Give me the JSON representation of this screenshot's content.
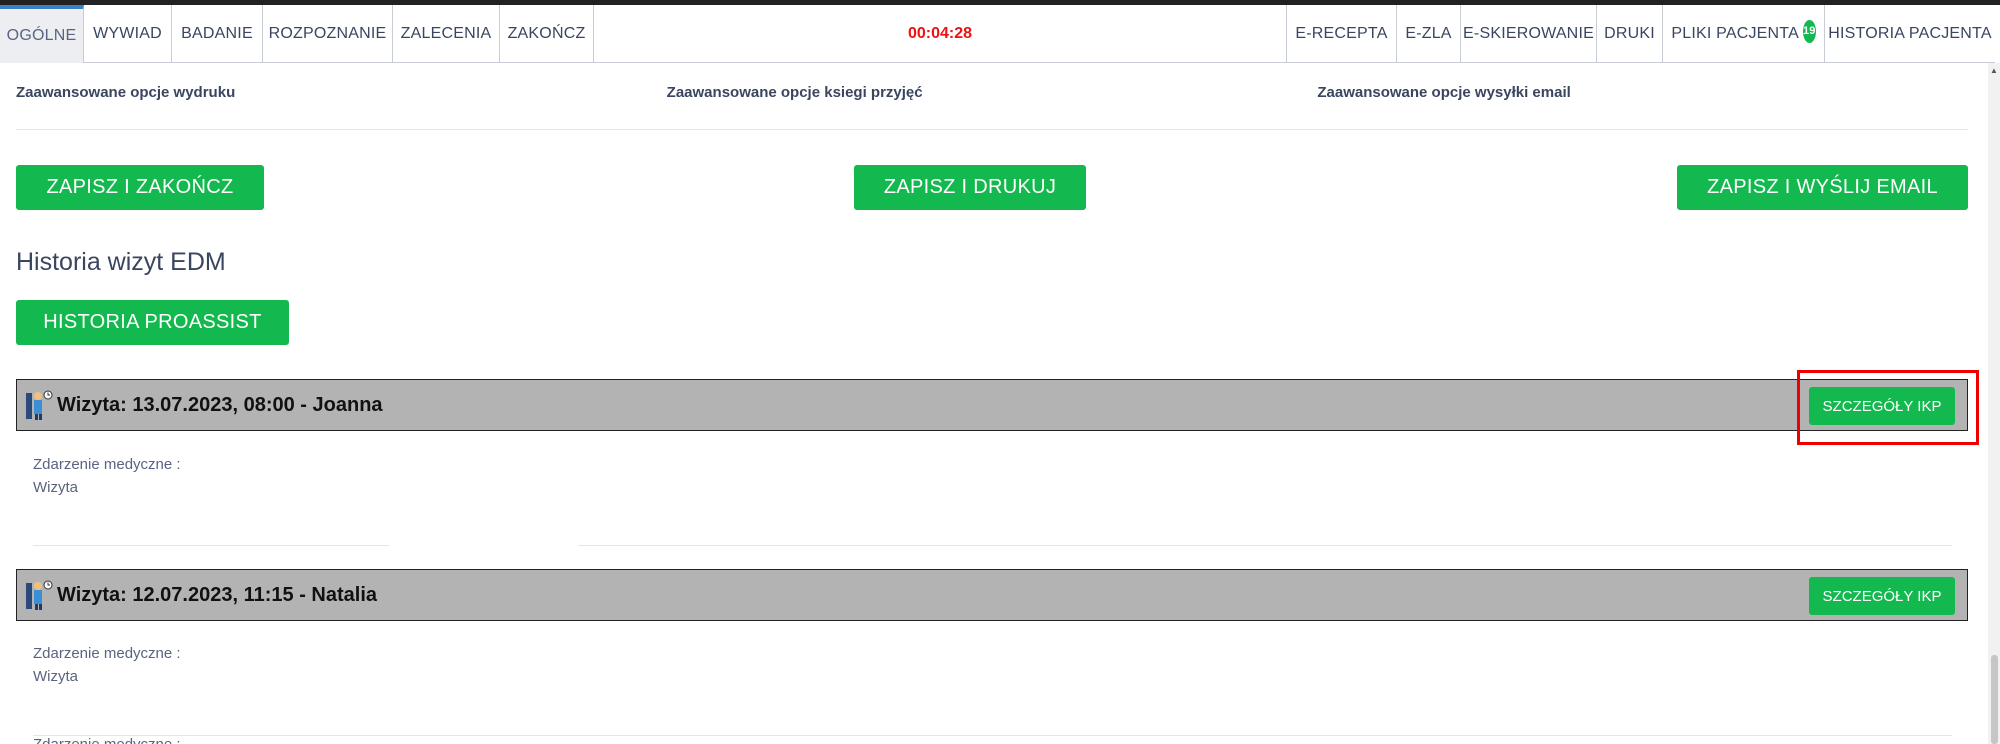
{
  "nav": {
    "tabs_left": [
      "OGÓLNE",
      "WYWIAD",
      "BADANIE",
      "ROZPOZNANIE",
      "ZALECENIA",
      "ZAKOŃCZ"
    ],
    "timer": "00:04:28",
    "tabs_right": [
      "E-RECEPTA",
      "E-ZLA",
      "E-SKIEROWANIE",
      "DRUKI",
      "PLIKI PACJENTA",
      "HISTORIA PACJENTA"
    ],
    "files_badge": "19",
    "active_tab": "OGÓLNE"
  },
  "options": {
    "print": "Zaawansowane opcje wydruku",
    "book": "Zaawansowane opcje ksiegi przyjęć",
    "email": "Zaawansowane opcje wysyłki email"
  },
  "actions": {
    "save_finish": "ZAPISZ I ZAKOŃCZ",
    "save_print": "ZAPISZ I DRUKUJ",
    "save_email": "ZAPISZ I WYŚLIJ EMAIL"
  },
  "history": {
    "title": "Historia wizyt EDM",
    "proassist_button": "HISTORIA PROASSIST",
    "visits": [
      {
        "title": "Wizyta: 13.07.2023, 08:00 - Joanna",
        "details_button": "SZCZEGÓŁY IKP",
        "event_label": "Zdarzenie medyczne :",
        "event_value": "Wizyta"
      },
      {
        "title": "Wizyta: 12.07.2023, 11:15 - Natalia",
        "details_button": "SZCZEGÓŁY IKP",
        "event_label": "Zdarzenie medyczne :",
        "event_value": "Wizyta"
      }
    ],
    "third_event_label": "Zdarzenie medyczne :"
  },
  "colors": {
    "accent_green": "#13b94f",
    "timer_red": "#e11111",
    "visit_header_bg": "#b3b3b3",
    "highlight_red": "#e00000"
  }
}
